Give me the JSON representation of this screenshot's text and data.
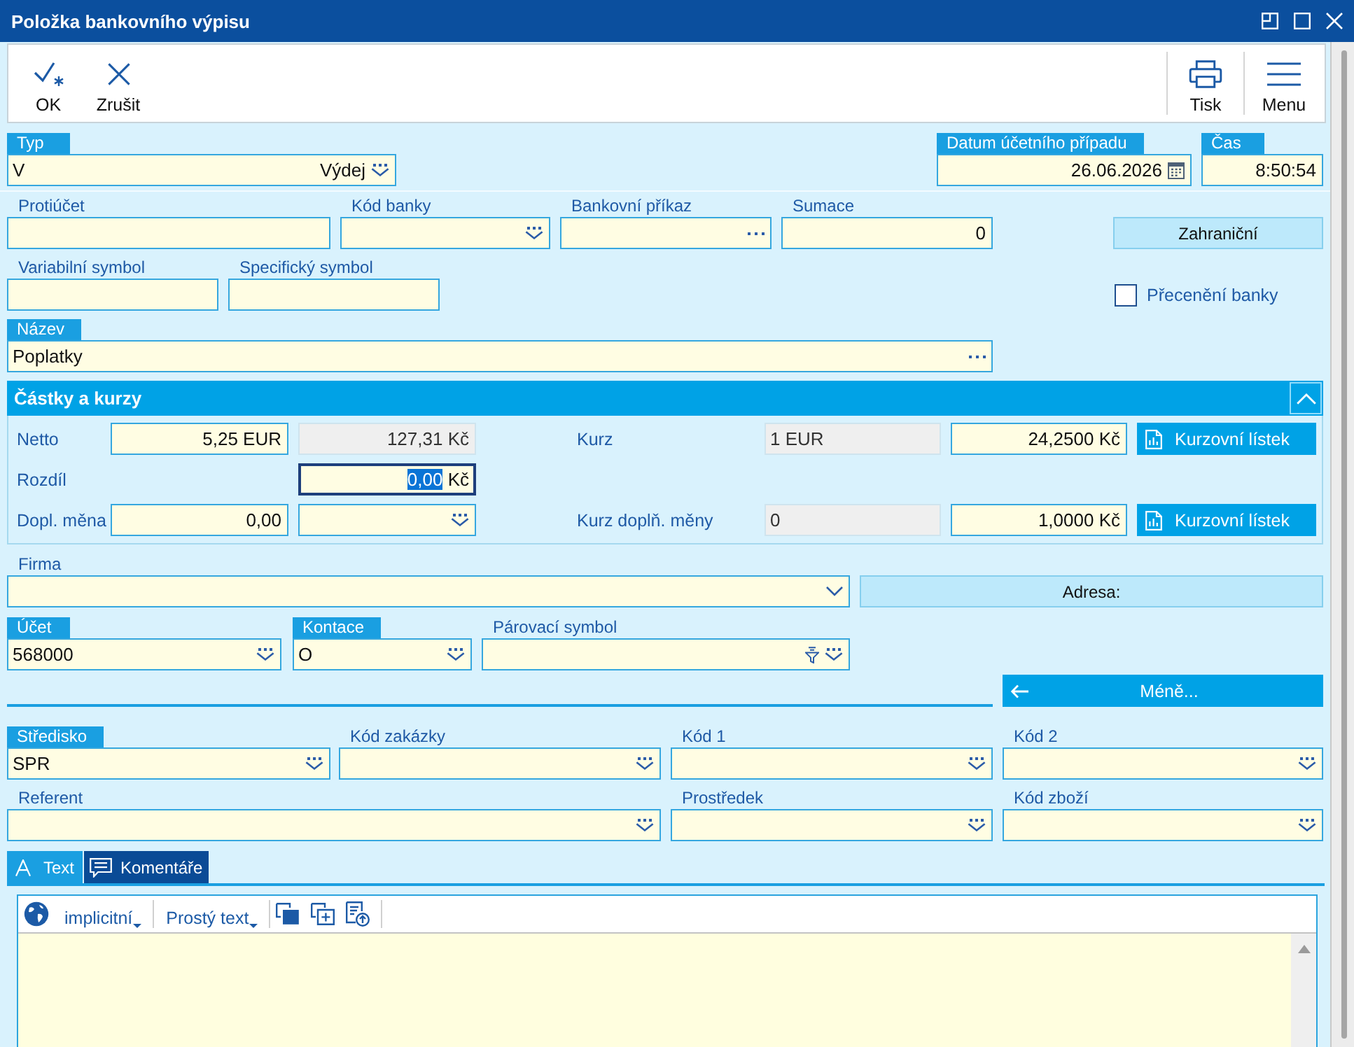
{
  "window": {
    "title": "Položka bankovního výpisu"
  },
  "toolbar": {
    "left": [
      {
        "kind": "confirm",
        "label": "OK"
      },
      {
        "kind": "cancel",
        "label": "Zrušit"
      }
    ],
    "right": [
      {
        "kind": "print",
        "label": "Tisk"
      },
      {
        "kind": "menu",
        "label": "Menu"
      }
    ]
  },
  "top_form": {
    "rows": [
      [
        {
          "kind": "select",
          "label": "Typ",
          "highlighted": true,
          "value": "V",
          "note": "Výdej"
        },
        {
          "kind": "date",
          "label": "Datum účetního případu",
          "highlighted": true,
          "value": "26.06.2026"
        },
        {
          "kind": "time",
          "label": "Čas",
          "highlighted": true,
          "value": "8:50:54"
        }
      ],
      [
        {
          "kind": "text",
          "label": "Protiúčet",
          "highlighted": false
        },
        {
          "kind": "select",
          "label": "Kód banky",
          "highlighted": false
        },
        {
          "kind": "lookup",
          "label": "Bankovní příkaz",
          "highlighted": false
        },
        {
          "kind": "number",
          "label": "Sumace",
          "highlighted": false,
          "value": "0"
        },
        {
          "kind": "button",
          "label": "Zahraniční"
        }
      ],
      [
        {
          "kind": "text",
          "label": "Variabilní symbol",
          "highlighted": false
        },
        {
          "kind": "text",
          "label": "Specifický symbol",
          "highlighted": false
        },
        {
          "kind": "checkbox",
          "label": "Přecenění banky",
          "checked": false
        }
      ],
      [
        {
          "kind": "lookup",
          "label": "Název",
          "highlighted": true,
          "value": "Poplatky"
        }
      ]
    ]
  },
  "amounts": {
    "title": "Částky a kurzy",
    "expanded": true,
    "rows": [
      [
        {
          "kind": "label",
          "text": "Netto"
        },
        {
          "kind": "number",
          "value": "5,25",
          "unit": "EUR",
          "readonly": false,
          "focused": false,
          "value_selected": false
        },
        {
          "kind": "number",
          "value": "127,31",
          "unit": "Kč",
          "readonly": true,
          "focused": false,
          "value_selected": false
        },
        {
          "kind": "label",
          "text": "Kurz"
        },
        {
          "kind": "text",
          "value": "1 EUR",
          "readonly": true,
          "focused": false,
          "value_selected": false
        },
        {
          "kind": "number",
          "value": "24,2500",
          "unit": "Kč",
          "readonly": false,
          "focused": false,
          "value_selected": false
        },
        {
          "kind": "chart-button",
          "label": "Kurzovní lístek"
        }
      ],
      [
        {
          "kind": "label",
          "text": "Rozdíl"
        },
        "",
        {
          "kind": "number",
          "value": "0,00",
          "unit": "Kč",
          "readonly": false,
          "focused": true,
          "value_selected": true
        }
      ],
      [
        {
          "kind": "label",
          "text": "Dopl. měna"
        },
        {
          "kind": "number",
          "value": "0,00",
          "readonly": false,
          "focused": false,
          "value_selected": false
        },
        {
          "kind": "select",
          "readonly": false,
          "focused": false
        },
        {
          "kind": "label",
          "text": "Kurz doplň. měny"
        },
        {
          "kind": "text",
          "value": "0",
          "readonly": true,
          "focused": false,
          "value_selected": false
        },
        {
          "kind": "number",
          "value": "1,0000",
          "unit": "Kč",
          "readonly": false,
          "focused": false,
          "value_selected": false
        },
        {
          "kind": "chart-button",
          "label": "Kurzovní lístek"
        }
      ]
    ]
  },
  "bottom_form": {
    "rows": [
      [
        {
          "kind": "combo",
          "label": "Firma",
          "highlighted": false
        },
        {
          "kind": "button",
          "label": "Adresa:"
        }
      ],
      [
        {
          "kind": "select",
          "label": "Účet",
          "highlighted": true,
          "value": "568000"
        },
        {
          "kind": "select",
          "label": "Kontace",
          "highlighted": true,
          "value": "O"
        },
        {
          "kind": "filter-select",
          "label": "Párovací symbol",
          "highlighted": false
        }
      ],
      [
        {
          "kind": "back-button",
          "label": "Méně..."
        }
      ],
      [
        {
          "kind": "select",
          "label": "Středisko",
          "highlighted": true,
          "value": "SPR"
        },
        {
          "kind": "select",
          "label": "Kód zakázky",
          "highlighted": false
        },
        {
          "kind": "select",
          "label": "Kód 1",
          "highlighted": false
        },
        {
          "kind": "select",
          "label": "Kód 2",
          "highlighted": false
        }
      ],
      [
        {
          "kind": "select",
          "label": "Referent",
          "highlighted": false
        },
        "",
        {
          "kind": "select",
          "label": "Prostředek",
          "highlighted": false
        },
        {
          "kind": "select",
          "label": "Kód zboží",
          "highlighted": false
        }
      ]
    ]
  },
  "tabs": [
    {
      "kind": "text",
      "label": "Text",
      "selected": true
    },
    {
      "kind": "comments",
      "label": "Komentáře",
      "selected": false
    }
  ],
  "editor": {
    "language": "implicitní",
    "format": "Prostý text"
  }
}
